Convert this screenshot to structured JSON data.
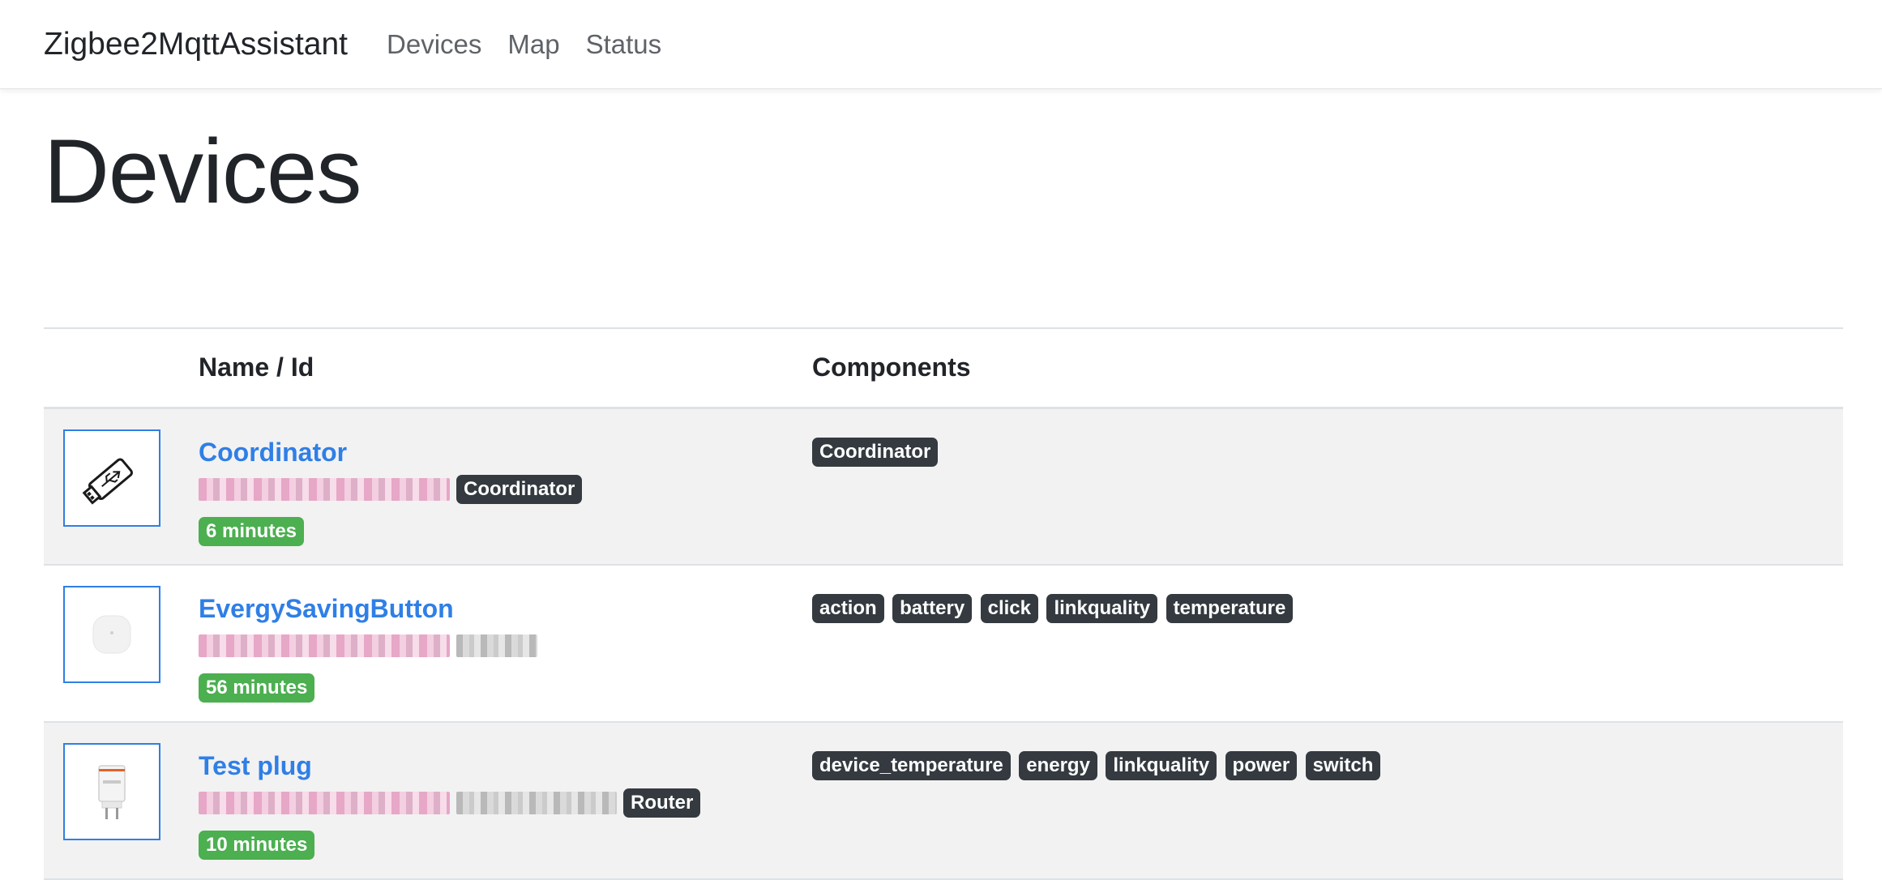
{
  "nav": {
    "brand": "Zigbee2MqttAssistant",
    "links": [
      "Devices",
      "Map",
      "Status"
    ]
  },
  "page": {
    "title": "Devices"
  },
  "table": {
    "headers": [
      "",
      "Name / Id",
      "Components"
    ],
    "rows": [
      {
        "name": "Coordinator",
        "type_badge": "Coordinator",
        "last_seen": "6 minutes",
        "icon": "usb-stick-icon",
        "components": [
          "Coordinator"
        ]
      },
      {
        "name": "EvergySavingButton",
        "type_badge": "",
        "last_seen": "56 minutes",
        "icon": "round-button-icon",
        "components": [
          "action",
          "battery",
          "click",
          "linkquality",
          "temperature"
        ]
      },
      {
        "name": "Test plug",
        "type_badge": "Router",
        "last_seen": "10 minutes",
        "icon": "smart-plug-icon",
        "components": [
          "device_temperature",
          "energy",
          "linkquality",
          "power",
          "switch"
        ]
      }
    ]
  },
  "colors": {
    "link": "#2f7fe6",
    "badge_dark": "#343a40",
    "badge_green": "#4caf50",
    "row_shaded": "#f2f2f2"
  }
}
